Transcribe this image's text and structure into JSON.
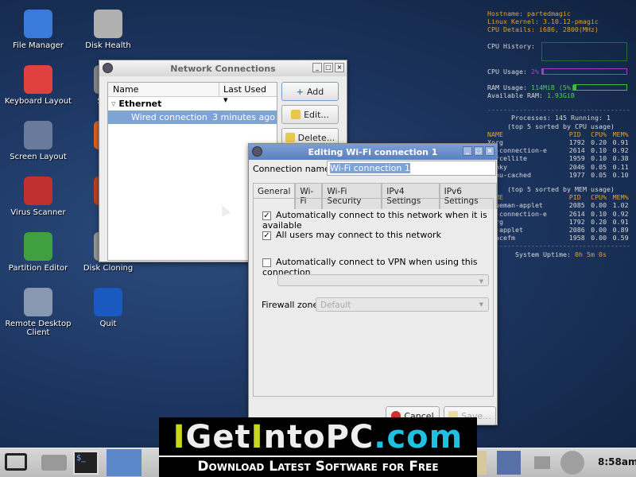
{
  "desktop_icons": [
    {
      "label": "File Manager",
      "color": "#3a7ad8"
    },
    {
      "label": "Disk Health",
      "color": "#b0b0b0"
    },
    {
      "label": "Keyboard Layout",
      "color": "#e04040"
    },
    {
      "label": "Syste",
      "color": "#888"
    },
    {
      "label": "Screen Layout",
      "color": "#6a7a9a"
    },
    {
      "label": "Web",
      "color": "#e06020"
    },
    {
      "label": "Virus Scanner",
      "color": "#c03030"
    },
    {
      "label": "Er",
      "color": "#c04020"
    },
    {
      "label": "Partition Editor",
      "color": "#40a040"
    },
    {
      "label": "Disk Cloning",
      "color": "#999"
    },
    {
      "label": "Remote Desktop Client",
      "color": "#8898b0"
    },
    {
      "label": "Quit",
      "color": "#1a5ac0"
    }
  ],
  "network_window": {
    "title": "Network Connections",
    "col_name": "Name",
    "col_last_used": "Last Used",
    "group": "Ethernet",
    "row": {
      "name": "Wired connection 1",
      "last_used": "3 minutes ago"
    },
    "add": "Add",
    "edit": "Edit...",
    "delete": "Delete..."
  },
  "edit_window": {
    "title": "Editing Wi-Fi connection 1",
    "conn_name_label": "Connection name:",
    "conn_name_value": "Wi-Fi connection 1",
    "tabs": [
      "General",
      "Wi-Fi",
      "Wi-Fi Security",
      "IPv4 Settings",
      "IPv6 Settings"
    ],
    "auto_connect": {
      "label": "Automatically connect to this network when it is available",
      "checked": true
    },
    "all_users": {
      "label": "All users may connect to this network",
      "checked": true
    },
    "vpn": {
      "label": "Automatically connect to VPN when using this connection",
      "checked": false
    },
    "firewall_label": "Firewall zone:",
    "firewall_value": "Default",
    "cancel": "Cancel",
    "save": "Save..."
  },
  "conky": {
    "hostname_label": "Hostname:",
    "hostname": "partedmagic",
    "kernel_label": "Linux Kernel:",
    "kernel": "3.10.12-pmagic",
    "cpu_label": "CPU Details:",
    "cpu": "i686, 2800(MHz)",
    "cpu_history": "CPU History:",
    "cpu_usage_label": "CPU Usage:",
    "cpu_usage": "2%",
    "cpu_usage_pct": 2,
    "ram_usage_label": "RAM Usage:",
    "ram_usage": "114MiB (5%)",
    "ram_usage_pct": 5,
    "avail_label": "Available RAM:",
    "avail": "1.93GiB",
    "processes": "Processes: 145  Running: 1",
    "cpu_sorted": "(top 5 sorted by CPU usage)",
    "mem_sorted": "(top 5 sorted by MEM usage)",
    "headers": [
      "NAME",
      "PID",
      "CPU%",
      "MEM%"
    ],
    "cpu_rows": [
      [
        "Xorg",
        "1792",
        "0.20",
        "0.91"
      ],
      [
        "nm-connection-e",
        "2614",
        "0.10",
        "0.92"
      ],
      [
        "parcellite",
        "1959",
        "0.10",
        "0.38"
      ],
      [
        "conky",
        "2046",
        "0.05",
        "0.11"
      ],
      [
        "menu-cached",
        "1977",
        "0.05",
        "0.10"
      ]
    ],
    "mem_rows": [
      [
        "blueman-applet",
        "2085",
        "0.00",
        "1.02"
      ],
      [
        "nm-connection-e",
        "2614",
        "0.10",
        "0.92"
      ],
      [
        "Xorg",
        "1792",
        "0.20",
        "0.91"
      ],
      [
        "nm-applet",
        "2086",
        "0.00",
        "0.89"
      ],
      [
        "spacefm",
        "1958",
        "0.00",
        "0.59"
      ]
    ],
    "uptime_label": "System Uptime:",
    "uptime": "0h 5m 0s"
  },
  "banner": {
    "logo": "IGetIntoPC.com",
    "tagline": "Download Latest Software for Free"
  },
  "taskbar": {
    "clock": "8:58am"
  }
}
